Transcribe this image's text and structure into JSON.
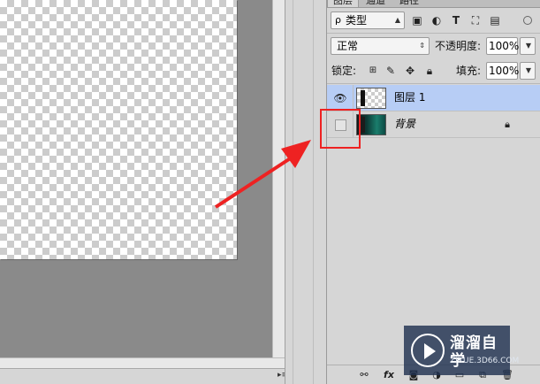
{
  "tabs": [
    {
      "label": "图层",
      "active": true
    },
    {
      "label": "通道",
      "active": false
    },
    {
      "label": "路径",
      "active": false
    }
  ],
  "filter": {
    "search_glyph": "ρ",
    "kind_label": "类型",
    "icons": [
      "image-filter-icon",
      "adjustment-filter-icon",
      "type-filter-icon",
      "shape-filter-icon",
      "smart-object-filter-icon"
    ]
  },
  "blend": {
    "mode": "正常",
    "opacity_label": "不透明度:",
    "opacity_value": "100%"
  },
  "lock": {
    "label": "锁定:",
    "fill_label": "填充:",
    "fill_value": "100%"
  },
  "layers": [
    {
      "name": "图层 1",
      "visible": true,
      "selected": true,
      "locked": false
    },
    {
      "name": "背景",
      "visible": false,
      "selected": false,
      "locked": true
    }
  ],
  "bottom_icons": [
    "link-layers-icon",
    "fx-icon",
    "mask-icon",
    "adjustment-layer-icon",
    "group-icon",
    "new-layer-icon",
    "delete-icon"
  ],
  "fx_label": "fx",
  "watermark": {
    "title": "溜溜自学",
    "url": "ZIXUE.3D66.COM"
  },
  "colors": {
    "selection": "#b7cdf5",
    "annotation": "#ee2222",
    "panel_bg": "#d6d6d6"
  }
}
